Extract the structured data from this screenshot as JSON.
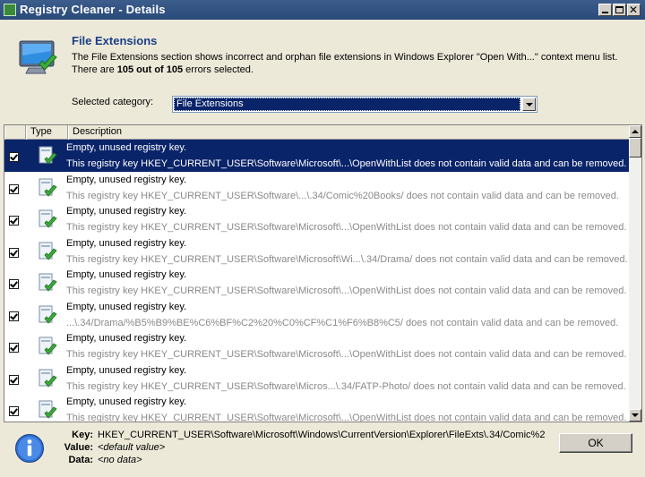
{
  "window": {
    "title": "Registry Cleaner - Details"
  },
  "header": {
    "title": "File Extensions",
    "desc_line1": "The File Extensions section shows incorrect and orphan file extensions in Windows Explorer \"Open With...\" context menu list.",
    "desc_prefix": "There are ",
    "desc_count": "105 out of 105",
    "desc_suffix": " errors selected."
  },
  "category": {
    "label": "Selected category:",
    "selected": "File Extensions"
  },
  "list": {
    "columns": [
      "",
      "Type",
      "Description"
    ],
    "rows": [
      {
        "title": "Empty, unused registry key.",
        "detail": "This registry key HKEY_CURRENT_USER\\Software\\Microsoft\\...\\OpenWithList does not contain valid data and can be removed.",
        "checked": true,
        "selected": true
      },
      {
        "title": "Empty, unused registry key.",
        "detail": "This registry key HKEY_CURRENT_USER\\Software\\...\\.34/Comic%20Books/ does not contain valid data and can be removed.",
        "checked": true,
        "selected": false
      },
      {
        "title": "Empty, unused registry key.",
        "detail": "This registry key HKEY_CURRENT_USER\\Software\\Microsoft\\...\\OpenWithList does not contain valid data and can be removed.",
        "checked": true,
        "selected": false
      },
      {
        "title": "Empty, unused registry key.",
        "detail": "This registry key HKEY_CURRENT_USER\\Software\\Microsoft\\Wi...\\.34/Drama/ does not contain valid data and can be removed.",
        "checked": true,
        "selected": false
      },
      {
        "title": "Empty, unused registry key.",
        "detail": "This registry key HKEY_CURRENT_USER\\Software\\Microsoft\\...\\OpenWithList does not contain valid data and can be removed.",
        "checked": true,
        "selected": false
      },
      {
        "title": "Empty, unused registry key.",
        "detail": "...\\.34/Drama/%B5%B9%BE%C6%BF%C2%20%C0%CF%C1%F6%B8%C5/ does not contain valid data and can be removed.",
        "checked": true,
        "selected": false
      },
      {
        "title": "Empty, unused registry key.",
        "detail": "This registry key HKEY_CURRENT_USER\\Software\\Microsoft\\...\\OpenWithList does not contain valid data and can be removed.",
        "checked": true,
        "selected": false
      },
      {
        "title": "Empty, unused registry key.",
        "detail": "This registry key HKEY_CURRENT_USER\\Software\\Micros...\\.34/FATP-Photo/ does not contain valid data and can be removed.",
        "checked": true,
        "selected": false
      },
      {
        "title": "Empty, unused registry key.",
        "detail": "This registry key HKEY_CURRENT_USER\\Software\\Microsoft\\...\\OpenWithList does not contain valid data and can be removed.",
        "checked": true,
        "selected": false
      }
    ]
  },
  "details": {
    "key_label": "Key:",
    "key_value": "HKEY_CURRENT_USER\\Software\\Microsoft\\Windows\\CurrentVersion\\Explorer\\FileExts\\.34/Comic%2",
    "value_label": "Value:",
    "value_value": "<default value>",
    "data_label": "Data:",
    "data_value": "<no data>"
  },
  "buttons": {
    "ok": "OK"
  },
  "colors": {
    "title_accent": "#1b3f86",
    "selection": "#0a246a",
    "dialog_bg": "#ece9d8"
  },
  "icons": {
    "window": "registry-cleaner-icon",
    "header": "monitor-check-icon",
    "row_type": "registry-key-check-icon",
    "details": "info-icon"
  }
}
